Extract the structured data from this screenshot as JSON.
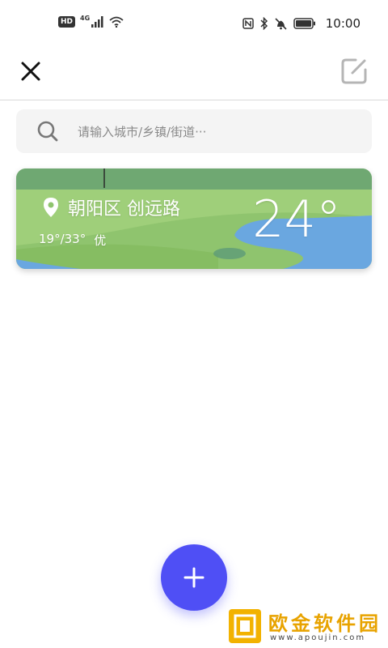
{
  "status_bar": {
    "hd_badge": "HD",
    "network": "4G",
    "time": "10:00"
  },
  "header": {
    "close_icon": "close-icon",
    "edit_icon": "edit-icon"
  },
  "search": {
    "placeholder": "请输入城市/乡镇/街道···",
    "icon": "search-icon"
  },
  "cities": [
    {
      "location": "朝阳区 创远路",
      "temp_range": "19°/33°",
      "air_quality": "优",
      "temperature": "24°"
    }
  ],
  "fab": {
    "icon": "plus-icon"
  },
  "watermark": {
    "text": "欧金软件园",
    "sub": "www.apoujin.com"
  },
  "colors": {
    "accent": "#4f4ff5",
    "card_green": "#8cc36a",
    "card_water": "#6aa7e0"
  }
}
